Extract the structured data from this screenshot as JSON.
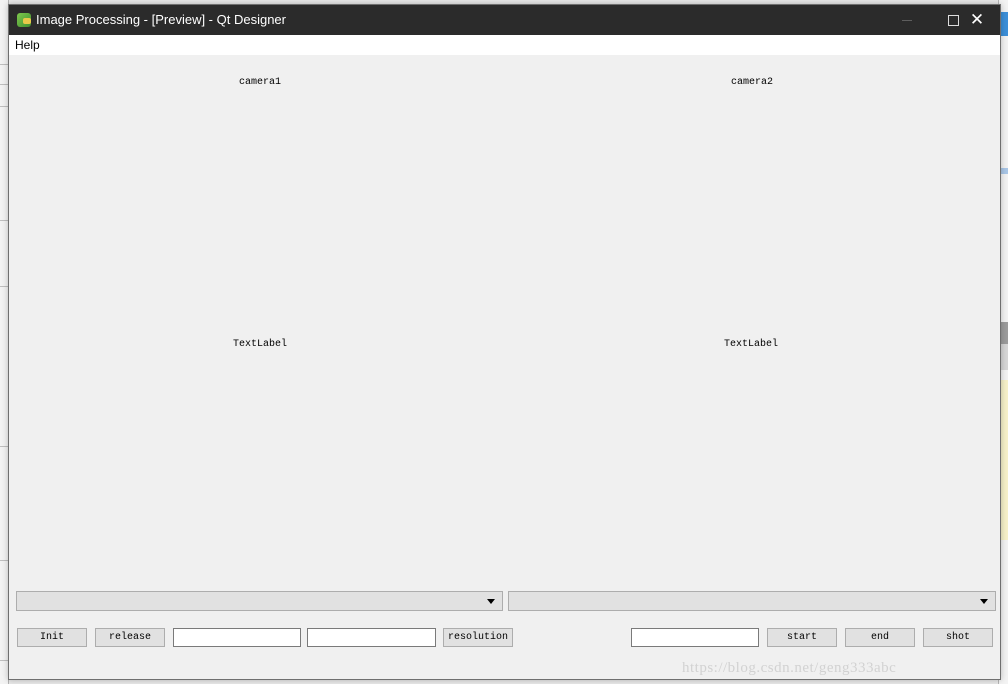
{
  "window": {
    "title": "Image Processing - [Preview] - Qt Designer",
    "controls": {
      "minimize": "—",
      "maximize": "☐",
      "close": "✕"
    }
  },
  "menubar": {
    "items": [
      {
        "label": "Help"
      }
    ]
  },
  "labels": {
    "camera1": "camera1",
    "camera2": "camera2",
    "text_label_1": "TextLabel",
    "text_label_2": "TextLabel"
  },
  "combos": [
    {
      "selected": ""
    },
    {
      "selected": ""
    }
  ],
  "buttons": {
    "init": "Init",
    "release": "release",
    "resolution": "resolution",
    "start": "start",
    "end": "end",
    "shot": "shot"
  },
  "inputs": {
    "width_value": "",
    "height_value": "",
    "filename_value": ""
  },
  "watermark": "https://blog.csdn.net/geng333abc"
}
